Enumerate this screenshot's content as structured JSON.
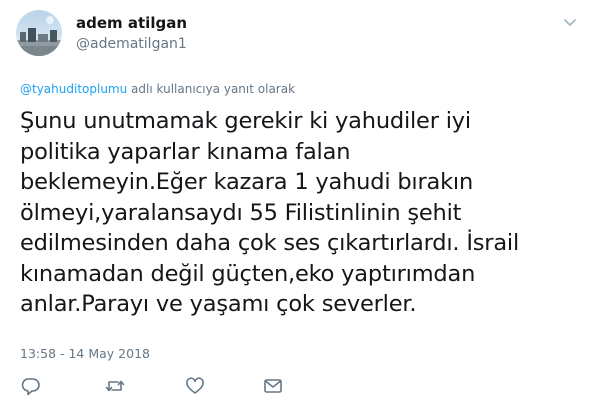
{
  "author": {
    "display_name": "adem atilgan",
    "handle": "@adematilgan1",
    "avatar_icon": "profile-photo"
  },
  "reply_context": {
    "mention": "@tyahuditoplumu",
    "suffix": " adlı kullanıcıya yanıt olarak"
  },
  "tweet": {
    "lines": [
      "Şunu unutmamak gerekir ki yahudiler iyi",
      "politika yaparlar kınama falan",
      "beklemeyin.Eğer kazara 1 yahudi bırakın",
      "ölmeyi,yaralansaydı 55 Filistinlinin şehit",
      "edilmesinden daha çok ses çıkartırlardı. İsrail",
      "kınamadan değil güçten,eko yaptırımdan",
      "anlar.Parayı ve yaşamı çok severler."
    ],
    "timestamp": "13:58 - 14 May 2018"
  },
  "actions": [
    {
      "name": "reply-icon",
      "icon": "speech-bubble"
    },
    {
      "name": "retweet-icon",
      "icon": "retweet-arrows"
    },
    {
      "name": "like-icon",
      "icon": "heart"
    },
    {
      "name": "share-icon",
      "icon": "envelope"
    }
  ],
  "colors": {
    "text": "#14171a",
    "secondary": "#657786",
    "link": "#1da1f2",
    "icon": "#657786"
  }
}
